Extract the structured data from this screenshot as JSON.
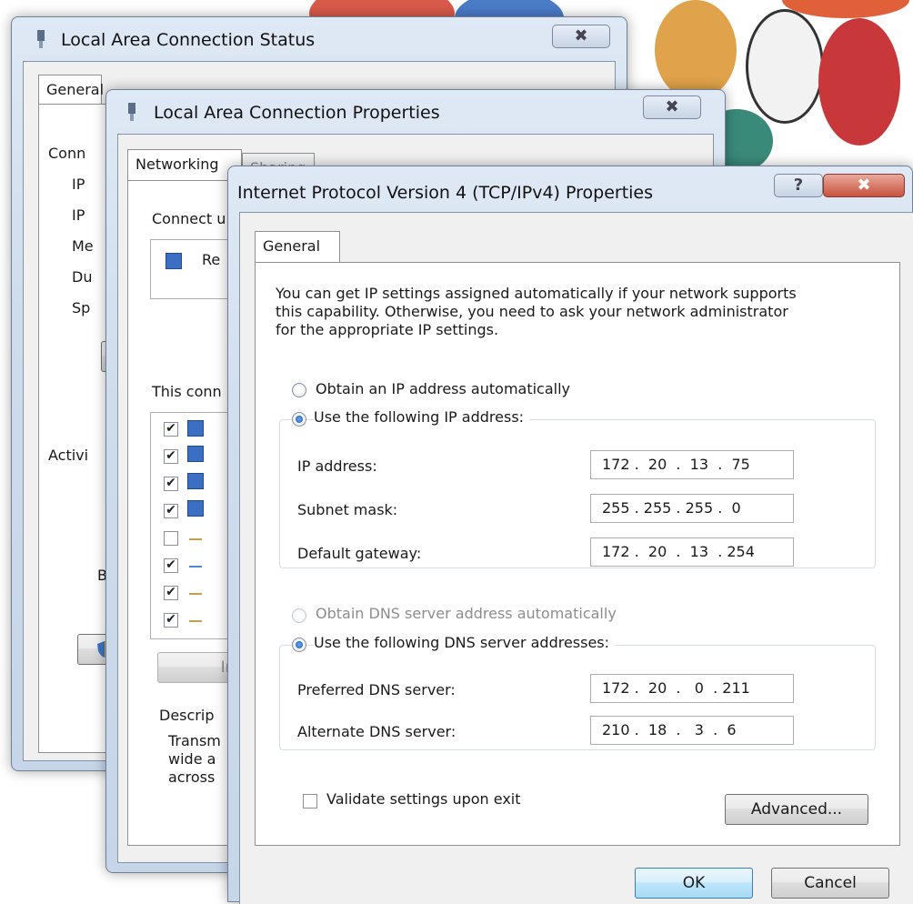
{
  "colors": {
    "accent": "#1d5fbf",
    "frame": "#cfdcec",
    "client": "#f0f0f0"
  },
  "status_window": {
    "title": "Local Area Connection Status",
    "close_label": "✖",
    "tab": "General",
    "labels": [
      "Conn",
      "IP",
      "IP",
      "Me",
      "Du",
      "Sp",
      "Activi",
      "By"
    ]
  },
  "properties_window": {
    "title": "Local Area Connection Properties",
    "close_label": "✖",
    "tabs": [
      "Networking",
      "Sharing"
    ],
    "connect_using": "Connect u",
    "adapter": "Re",
    "this_connection": "This conn",
    "install_button": "Ins",
    "description_label": "Descrip",
    "description_lines": [
      "Transm",
      "wide a",
      "across"
    ]
  },
  "ipv4_dialog": {
    "title": "Internet Protocol Version 4 (TCP/IPv4) Properties",
    "help_label": "?",
    "close_label": "✖",
    "tab": "General",
    "intro": [
      "You can get IP settings assigned automatically if your network supports",
      "this capability. Otherwise, you need to ask your network administrator",
      "for the appropriate IP settings."
    ],
    "obtain_ip_auto": "Obtain an IP address automatically",
    "use_following_ip": "Use the following IP address:",
    "ip_address_label": "IP address:",
    "ip_address": "172 .  20  .  13  .  75",
    "subnet_mask_label": "Subnet mask:",
    "subnet_mask": "255 . 255 . 255 .  0",
    "default_gateway_label": "Default gateway:",
    "default_gateway": "172 .  20  .  13  . 254",
    "obtain_dns_auto": "Obtain DNS server address automatically",
    "use_following_dns": "Use the following DNS server addresses:",
    "preferred_dns_label": "Preferred DNS server:",
    "preferred_dns": "172 .  20  .   0  . 211",
    "alternate_dns_label": "Alternate DNS server:",
    "alternate_dns": "210 .  18  .   3  .  6",
    "validate_label": "Validate settings upon exit",
    "advanced_button": "Advanced...",
    "ok_button": "OK",
    "cancel_button": "Cancel"
  }
}
